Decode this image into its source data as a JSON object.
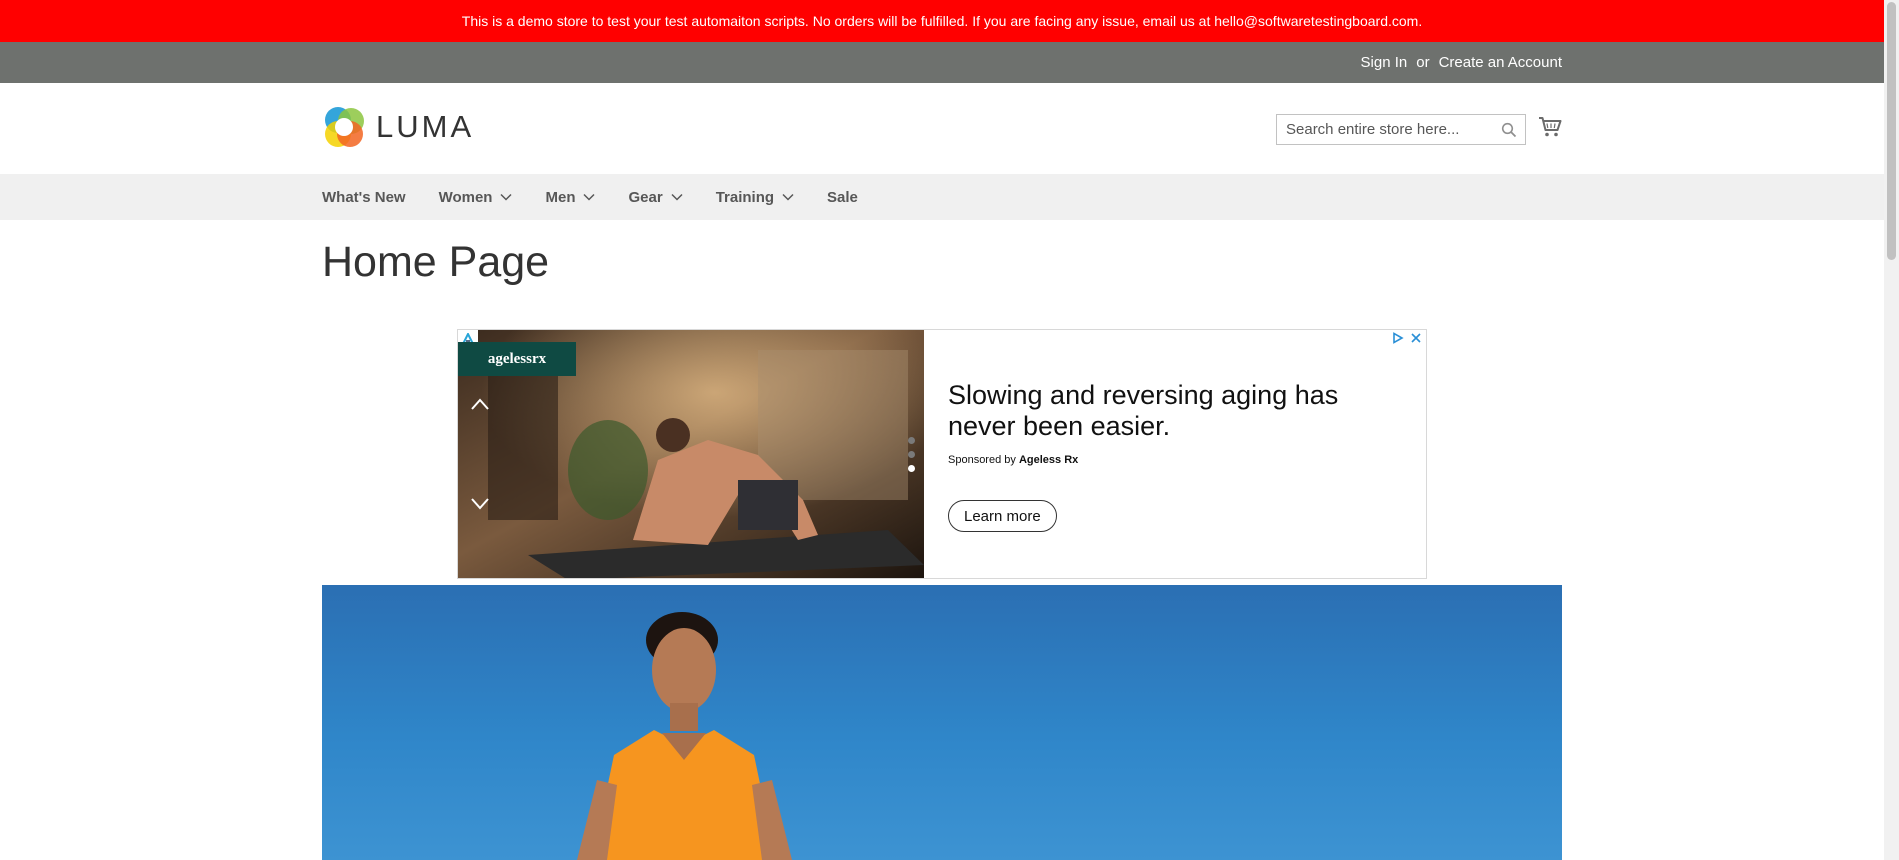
{
  "notice": {
    "text": "This is a demo store to test your test automaiton scripts. No orders will be fulfilled. If you are facing any issue, email us at hello@softwaretestingboard.com."
  },
  "panel": {
    "sign_in": "Sign In",
    "or": "or",
    "create_account": "Create an Account"
  },
  "header": {
    "logo_text": "LUMA",
    "search_placeholder": "Search entire store here...",
    "search_icon": "search-icon",
    "cart_icon": "cart-icon"
  },
  "nav": {
    "items": [
      {
        "label": "What's New",
        "has_dropdown": false
      },
      {
        "label": "Women",
        "has_dropdown": true
      },
      {
        "label": "Men",
        "has_dropdown": true
      },
      {
        "label": "Gear",
        "has_dropdown": true
      },
      {
        "label": "Training",
        "has_dropdown": true
      },
      {
        "label": "Sale",
        "has_dropdown": false
      }
    ]
  },
  "page": {
    "title": "Home Page"
  },
  "ad": {
    "brand": "agelessrx",
    "headline": "Slowing and reversing aging has never been easier.",
    "sponsor_prefix": "Sponsored by",
    "sponsor_name": "Ageless Rx",
    "cta": "Learn more",
    "dots_count": 3,
    "active_dot": 3
  },
  "colors": {
    "notice_bg": "#ff0000",
    "panel_bg": "#6e716e",
    "nav_bg": "#f0f0f0",
    "hero_blue": "#2f86c9"
  }
}
